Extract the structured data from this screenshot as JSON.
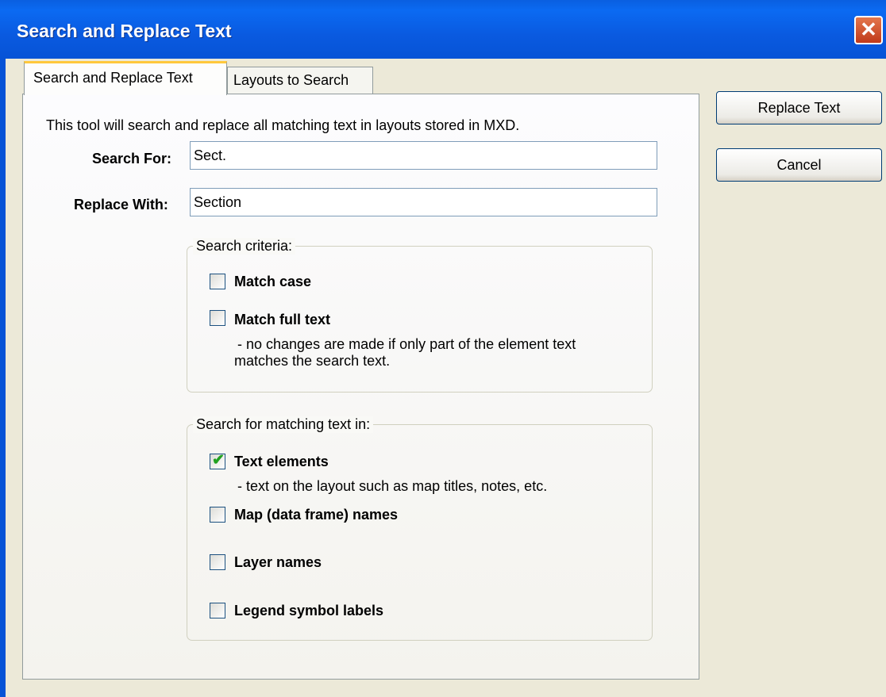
{
  "window": {
    "title": "Search and Replace Text",
    "close_glyph": "✕"
  },
  "tabs": [
    {
      "label": "Search and Replace Text",
      "active": true
    },
    {
      "label": "Layouts to Search",
      "active": false
    }
  ],
  "intro": "This tool will search and replace all matching text in layouts stored in MXD.",
  "search_for": {
    "label": "Search For:",
    "value": "Sect."
  },
  "replace_with": {
    "label": "Replace With:",
    "value": "Section"
  },
  "search_criteria": {
    "legend": "Search criteria:",
    "options": [
      {
        "label": "Match case",
        "checked": false
      },
      {
        "label": "Match full text",
        "checked": false,
        "note_line1": "- no changes are made if only part of the element text",
        "note_line2": "matches the search text."
      }
    ]
  },
  "search_in": {
    "legend": "Search for matching text in:",
    "options": [
      {
        "label": "Text elements",
        "checked": true,
        "note": "- text on the layout such as map titles, notes, etc."
      },
      {
        "label": "Map (data frame) names",
        "checked": false
      },
      {
        "label": "Layer names",
        "checked": false
      },
      {
        "label": "Legend symbol labels",
        "checked": false
      }
    ]
  },
  "buttons": {
    "replace": "Replace Text",
    "cancel": "Cancel"
  },
  "colors": {
    "titlebar": "#0a5fe0",
    "dialog_bg": "#ece9d8",
    "tab_accent": "#ffc83c",
    "check": "#21a121"
  }
}
